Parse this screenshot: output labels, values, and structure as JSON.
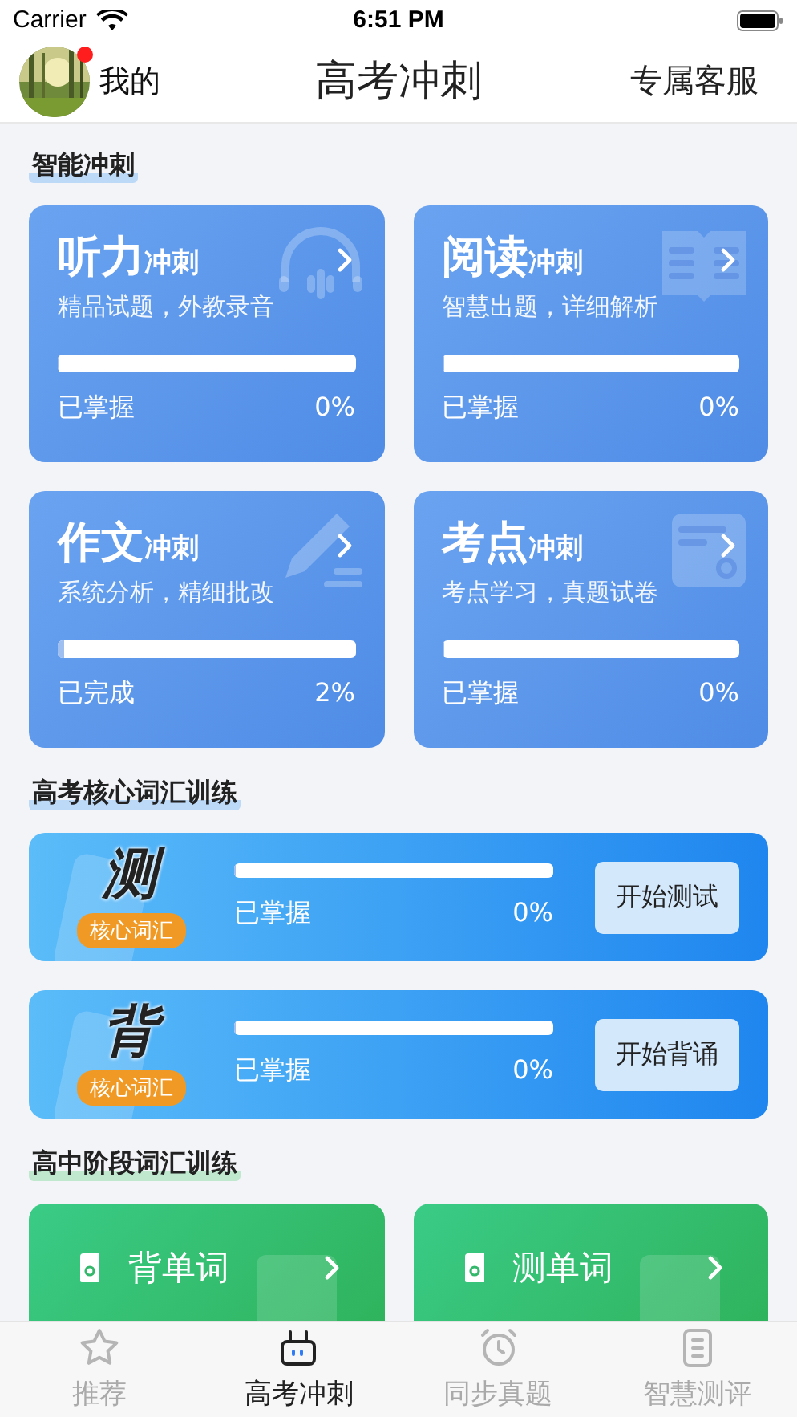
{
  "status_bar": {
    "carrier": "Carrier",
    "time": "6:51 PM"
  },
  "header": {
    "profile": "我的",
    "notification": true,
    "title": "高考冲刺",
    "service": "专属客服"
  },
  "smart_sprint": {
    "title": "智能冲刺",
    "cards": [
      {
        "title": "听力",
        "suffix": "冲刺",
        "desc": "精品试题，外教录音",
        "level": 0,
        "status": "已掌握",
        "percent": "0%"
      },
      {
        "title": "阅读",
        "suffix": "冲刺",
        "desc": "智慧出题，详细解析",
        "level": 0,
        "status": "已掌握",
        "percent": "0%"
      },
      {
        "title": "作文",
        "suffix": "冲刺",
        "desc": "系统分析，精细批改",
        "level": 0.02,
        "status": "已完成",
        "percent": "2%"
      },
      {
        "title": "考点",
        "suffix": "冲刺",
        "desc": "考点学习，真题试卷",
        "level": 0,
        "status": "已掌握",
        "percent": "0%"
      }
    ]
  },
  "core_vocab": {
    "title": "高考核心词汇训练",
    "cards": [
      {
        "char": "测",
        "ribbon": "核心词汇",
        "level": 0,
        "status": "已掌握",
        "percent": "0%",
        "button": "开始测试"
      },
      {
        "char": "背",
        "ribbon": "核心词汇",
        "level": 0,
        "status": "已掌握",
        "percent": "0%",
        "button": "开始背诵"
      }
    ]
  },
  "stage_vocab": {
    "title": "高中阶段词汇训练",
    "cards": [
      {
        "label": "背单词"
      },
      {
        "label": "测单词"
      }
    ]
  },
  "tabs": [
    {
      "label": "推荐",
      "selected": false
    },
    {
      "label": "高考冲刺",
      "selected": true
    },
    {
      "label": "同步真题",
      "selected": false
    },
    {
      "label": "智慧测评",
      "selected": false
    }
  ]
}
